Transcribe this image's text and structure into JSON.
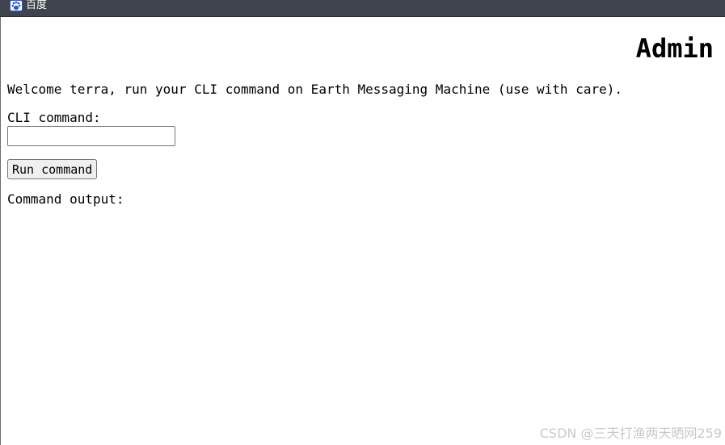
{
  "browser": {
    "bookmark_label": "百度",
    "bookmark_icon": "baidu-paw-icon"
  },
  "page": {
    "title": "Admin",
    "welcome_text": "Welcome terra, run your CLI command on Earth Messaging Machine (use with care).",
    "cli_label": "CLI command:",
    "cli_value": "",
    "run_button_label": "Run command",
    "output_label": "Command output:",
    "output_text": ""
  },
  "watermark": {
    "text": "CSDN @三天打渔两天晒网259"
  },
  "colors": {
    "topbar": "#3f434d",
    "watermark": "#c9c9c9"
  }
}
